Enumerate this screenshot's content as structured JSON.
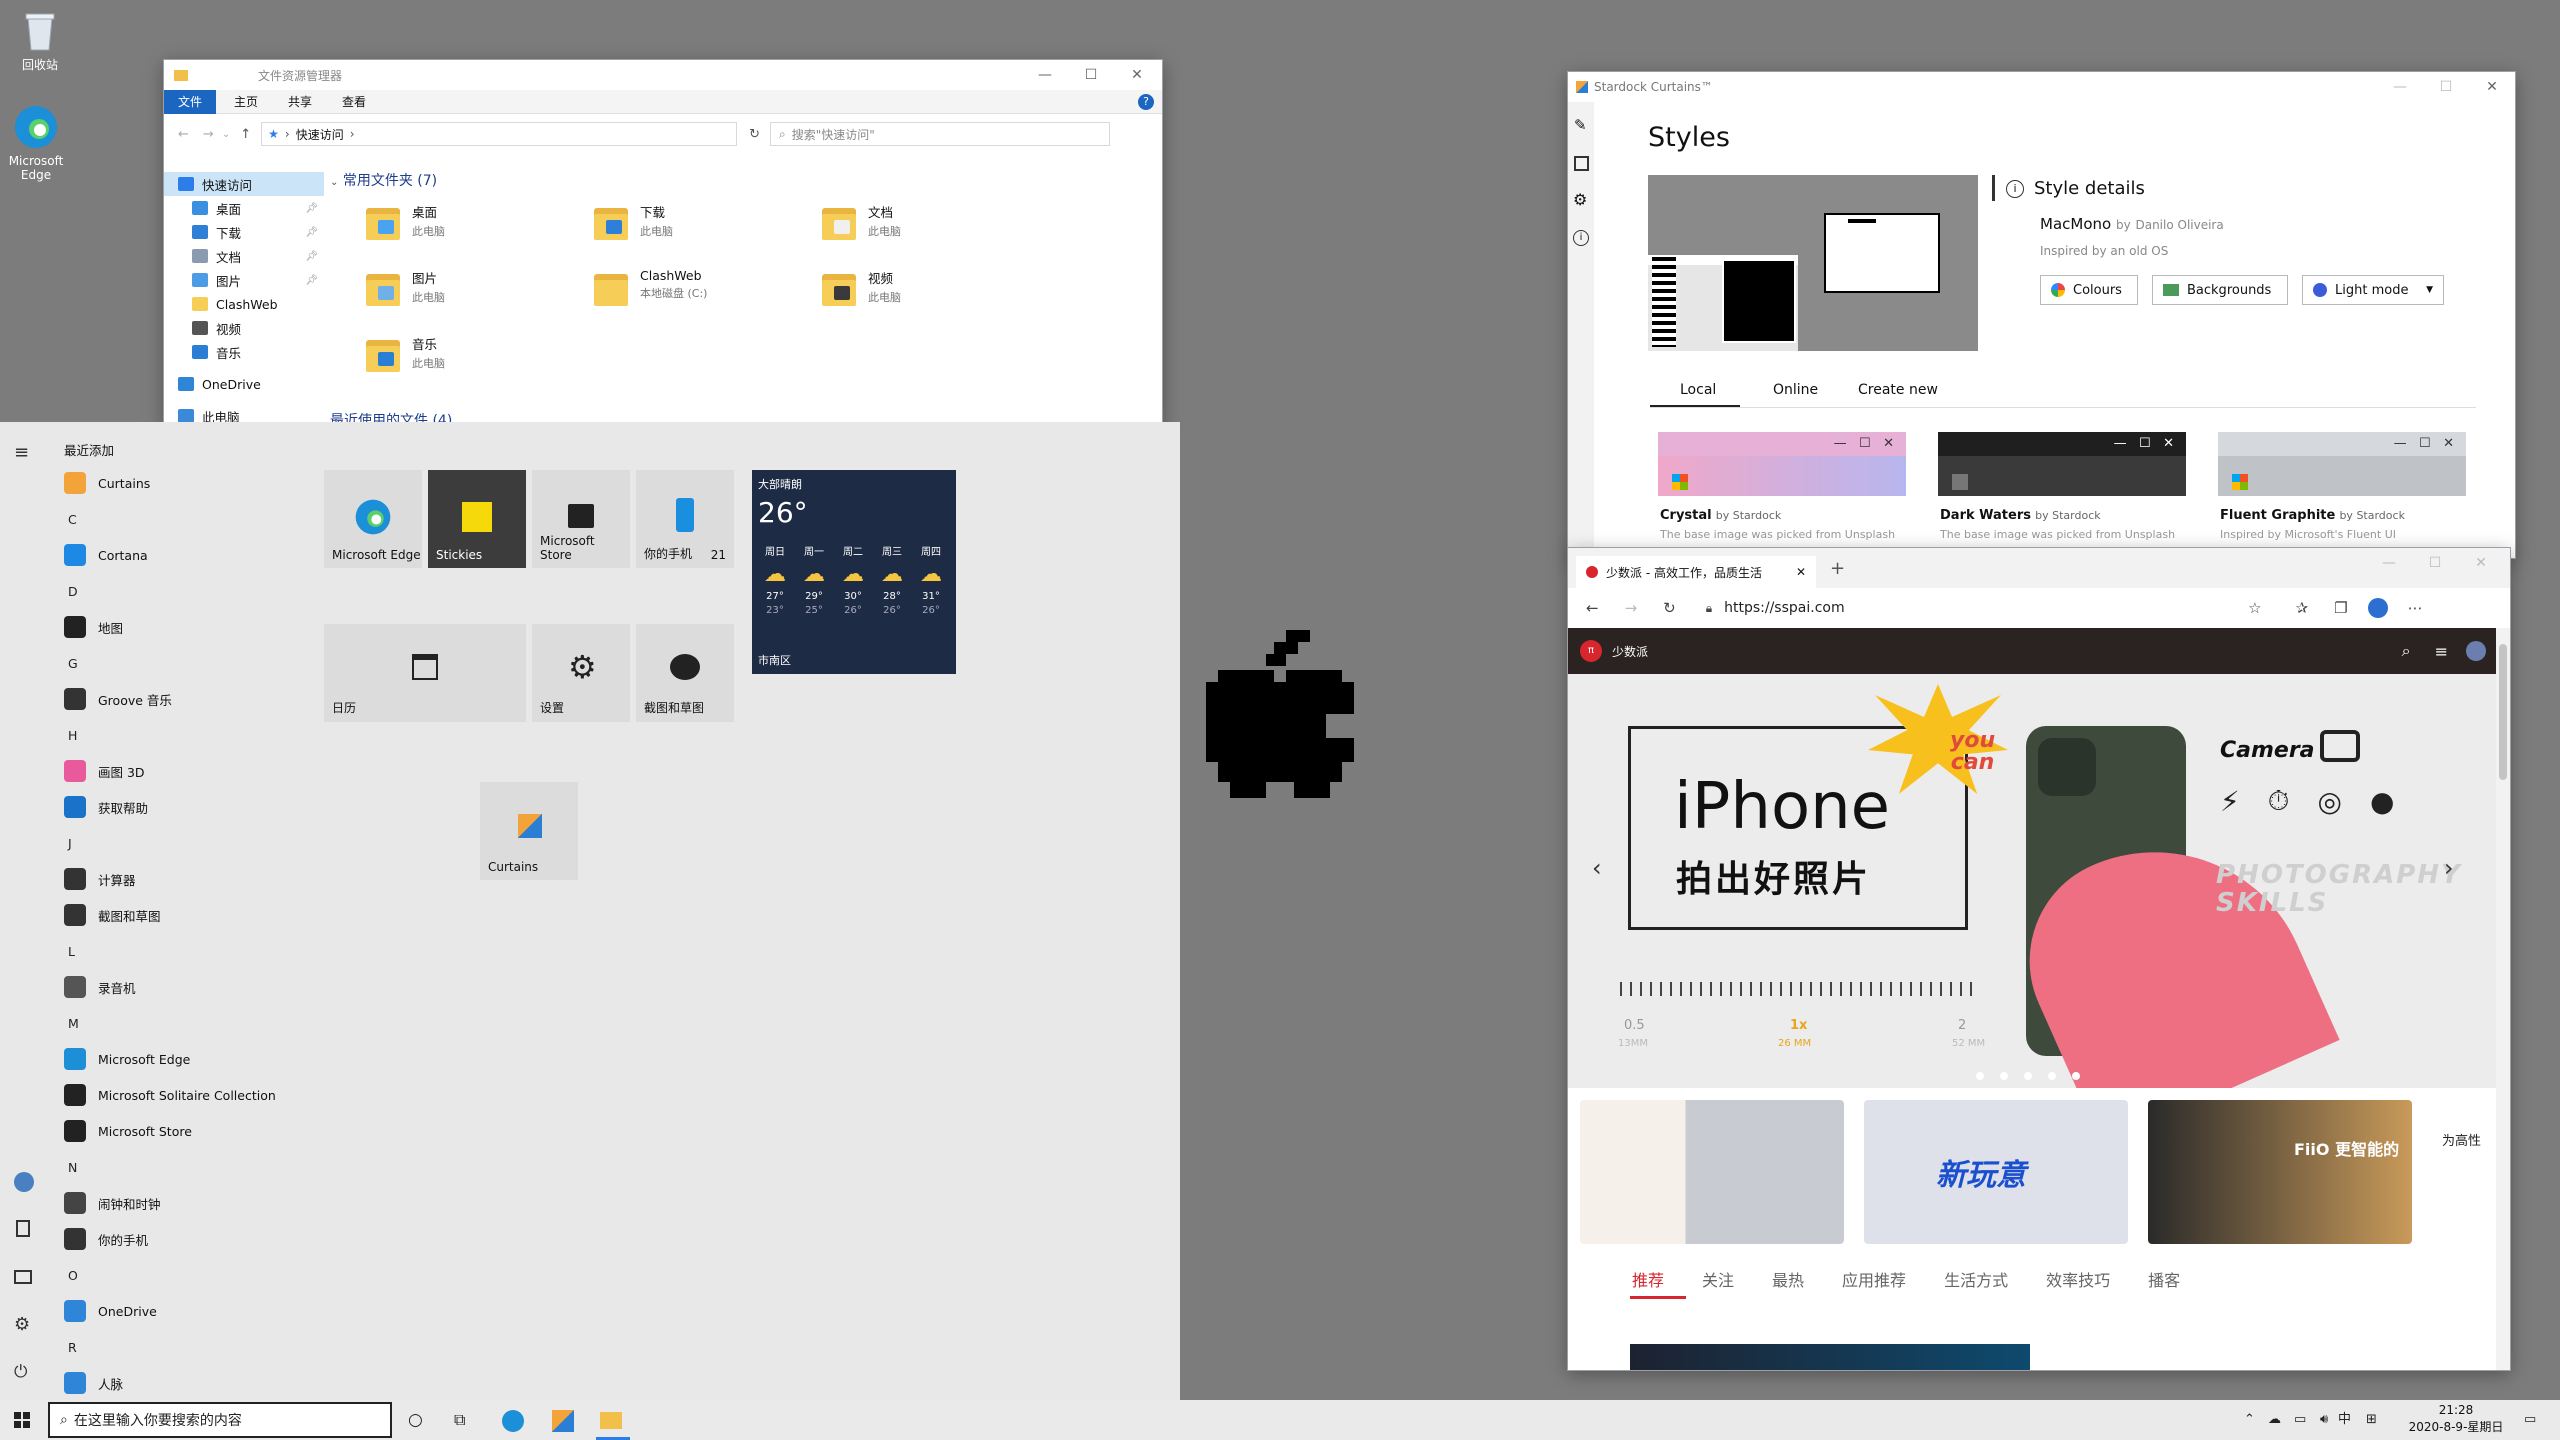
{
  "desktop": {
    "icons": [
      {
        "label": "回收站",
        "icon": "recycle-bin-icon"
      },
      {
        "label": "Microsoft Edge",
        "icon": "edge-icon"
      }
    ]
  },
  "explorer": {
    "title": "文件资源管理器",
    "ribbon": [
      "文件",
      "主页",
      "共享",
      "查看"
    ],
    "address": "快速访问",
    "search_placeholder": "搜索\"快速访问\"",
    "nav": [
      {
        "label": "快速访问",
        "pinned": false,
        "color": "#2b7de9"
      },
      {
        "label": "桌面",
        "pinned": true,
        "color": "#3a8fe0"
      },
      {
        "label": "下载",
        "pinned": true,
        "color": "#2d7fd8"
      },
      {
        "label": "文档",
        "pinned": true,
        "color": "#8b9bb0"
      },
      {
        "label": "图片",
        "pinned": true,
        "color": "#4c9be6"
      },
      {
        "label": "ClashWeb",
        "pinned": false,
        "color": "#f6cd57"
      },
      {
        "label": "视频",
        "pinned": false,
        "color": "#555555"
      },
      {
        "label": "音乐",
        "pinned": false,
        "color": "#2a7fd4"
      },
      {
        "label": "OneDrive",
        "pinned": false,
        "color": "#2f86d8"
      },
      {
        "label": "此电脑",
        "pinned": false,
        "color": "#3b8ad9"
      }
    ],
    "group_title": "常用文件夹 (7)",
    "group_title2": "最近使用的文件 (4)",
    "folders": [
      {
        "name": "桌面",
        "sub": "此电脑",
        "accent": "#4aa3ee"
      },
      {
        "name": "下载",
        "sub": "此电脑",
        "accent": "#2d7fd8"
      },
      {
        "name": "文档",
        "sub": "此电脑",
        "accent": "#f0f0f0"
      },
      {
        "name": "图片",
        "sub": "此电脑",
        "accent": "#6fb0e8"
      },
      {
        "name": "ClashWeb",
        "sub": "本地磁盘 (C:)",
        "accent": "#f6cd57"
      },
      {
        "name": "视频",
        "sub": "此电脑",
        "accent": "#3a3a3a"
      },
      {
        "name": "音乐",
        "sub": "此电脑",
        "accent": "#2a7fd4"
      }
    ]
  },
  "start_menu": {
    "recent_header": "最近添加",
    "apps": [
      {
        "type": "app",
        "label": "Curtains",
        "color": "#f2a33a"
      },
      {
        "type": "letter",
        "label": "C"
      },
      {
        "type": "app",
        "label": "Cortana",
        "color": "#1e88e5"
      },
      {
        "type": "letter",
        "label": "D"
      },
      {
        "type": "app",
        "label": "地图",
        "color": "#222222"
      },
      {
        "type": "letter",
        "label": "G"
      },
      {
        "type": "app",
        "label": "Groove 音乐",
        "color": "#333333"
      },
      {
        "type": "letter",
        "label": "H"
      },
      {
        "type": "app",
        "label": "画图 3D",
        "color": "#e85a9b"
      },
      {
        "type": "app",
        "label": "获取帮助",
        "color": "#1a73c8"
      },
      {
        "type": "letter",
        "label": "J"
      },
      {
        "type": "app",
        "label": "计算器",
        "color": "#333333"
      },
      {
        "type": "app",
        "label": "截图和草图",
        "color": "#333333"
      },
      {
        "type": "letter",
        "label": "L"
      },
      {
        "type": "app",
        "label": "录音机",
        "color": "#555555"
      },
      {
        "type": "letter",
        "label": "M"
      },
      {
        "type": "app",
        "label": "Microsoft Edge",
        "color": "#1c8fd6"
      },
      {
        "type": "app",
        "label": "Microsoft Solitaire Collection",
        "color": "#222222"
      },
      {
        "type": "app",
        "label": "Microsoft Store",
        "color": "#222222"
      },
      {
        "type": "letter",
        "label": "N"
      },
      {
        "type": "app",
        "label": "闹钟和时钟",
        "color": "#444444"
      },
      {
        "type": "app",
        "label": "你的手机",
        "color": "#333333"
      },
      {
        "type": "letter",
        "label": "O"
      },
      {
        "type": "app",
        "label": "OneDrive",
        "color": "#2f86d8"
      },
      {
        "type": "letter",
        "label": "R"
      },
      {
        "type": "app",
        "label": "人脉",
        "color": "#2f86d8"
      }
    ],
    "tiles": {
      "edge": "Microsoft Edge",
      "stickies": "Stickies",
      "store": "Microsoft Store",
      "phone": "你的手机",
      "phone_badge": "21",
      "calendar": "日历",
      "settings": "设置",
      "snip": "截图和草图",
      "curtains": "Curtains"
    },
    "weather": {
      "condition": "大部晴朗",
      "temp": "26°",
      "location": "市南区",
      "days": [
        {
          "day": "周日",
          "hi": "27°",
          "lo": "23°"
        },
        {
          "day": "周一",
          "hi": "29°",
          "lo": "25°"
        },
        {
          "day": "周二",
          "hi": "30°",
          "lo": "26°"
        },
        {
          "day": "周三",
          "hi": "28°",
          "lo": "26°"
        },
        {
          "day": "周四",
          "hi": "31°",
          "lo": "26°"
        }
      ]
    }
  },
  "curtains": {
    "title": "Stardock Curtains™",
    "heading": "Styles",
    "details_title": "Style details",
    "style_name": "MacMono",
    "by": "by",
    "author": "Danilo Oliveira",
    "inspired": "Inspired by an old OS",
    "buttons": {
      "colours": "Colours",
      "backgrounds": "Backgrounds",
      "mode": "Light mode"
    },
    "tabs": [
      "Local",
      "Online",
      "Create new"
    ],
    "styles": [
      {
        "name": "Crystal",
        "by": "by Stardock",
        "desc": "The base image was picked from Unsplash"
      },
      {
        "name": "Dark Waters",
        "by": "by Stardock",
        "desc": "The base image was picked from Unsplash"
      },
      {
        "name": "Fluent Graphite",
        "by": "by Stardock",
        "desc": "Inspired by Microsoft's Fluent UI"
      }
    ]
  },
  "browser": {
    "tab_title": "少数派 - 高效工作，品质生活",
    "url": "https://sspai.com",
    "site_name": "少数派",
    "hero": {
      "title1": "iPhone",
      "title2": "拍出好照片",
      "badge1": "you",
      "badge2": "can",
      "camera": "Camera",
      "photography": "PHOTOGRAPHY",
      "skills": "SKILLS",
      "zoom": [
        "0.5",
        "1x",
        "2"
      ],
      "mm": [
        "13MM",
        "26 MM",
        "52 MM"
      ]
    },
    "cards": [
      {
        "title": "新玩意"
      },
      {
        "title": "FiiO 更智能的"
      },
      {
        "title": "为高性"
      }
    ],
    "categories": [
      "推荐",
      "关注",
      "最热",
      "应用推荐",
      "生活方式",
      "效率技巧",
      "播客"
    ]
  },
  "taskbar": {
    "search_placeholder": "在这里输入你要搜索的内容",
    "ime": "中",
    "time": "21:28",
    "date": "2020-8-9-星期日"
  }
}
